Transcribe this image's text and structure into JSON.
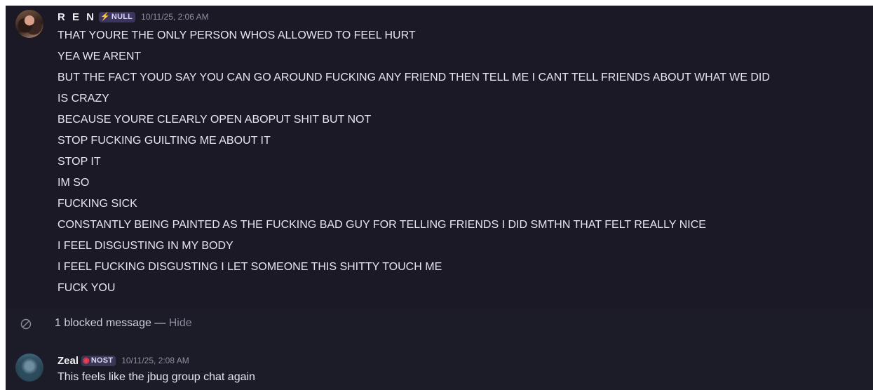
{
  "messages": [
    {
      "author": "R E N",
      "tag": {
        "label": "NULL",
        "icon": "lightning-bolt-icon",
        "icon_glyph": "⚡",
        "icon_color": "#f6c23a"
      },
      "timestamp": "10/11/25, 2:06 AM",
      "lines": [
        "THAT YOURE THE ONLY PERSON WHOS ALLOWED TO FEEL HURT",
        "YEA WE ARENT",
        "BUT THE FACT YOUD SAY YOU CAN GO AROUND FUCKING ANY FRIEND THEN TELL ME I CANT TELL FRIENDS ABOUT WHAT WE DID",
        "IS CRAZY",
        "BECAUSE YOURE CLEARLY OPEN ABOPUT SHIT BUT NOT",
        "STOP FUCKING GUILTING ME ABOUT IT",
        "STOP IT",
        "IM SO",
        "FUCKING SICK",
        "CONSTANTLY BEING PAINTED AS THE FUCKING BAD GUY FOR TELLING FRIENDS I DID SMTHN THAT FELT REALLY NICE",
        "I FEEL DISGUSTING IN MY BODY",
        "I FEEL FUCKING DISGUSTING I LET SOMEONE THIS SHITTY TOUCH ME",
        "FUCK YOU"
      ]
    },
    {
      "author": "Zeal",
      "tag": {
        "label": "NOST",
        "icon": "red-ring-icon",
        "icon_glyph": "◉",
        "icon_color": "#ee3d4e"
      },
      "timestamp": "10/11/25, 2:08 AM",
      "lines": [
        "This feels like the jbug group chat again"
      ]
    }
  ],
  "blocked": {
    "icon": "blocked-circle-icon",
    "text": "1 blocked message",
    "separator": " — ",
    "action_label": "Hide"
  },
  "colors": {
    "background": "#1c1b28",
    "text": "#e6e6ee",
    "muted": "#8f8fa0"
  }
}
